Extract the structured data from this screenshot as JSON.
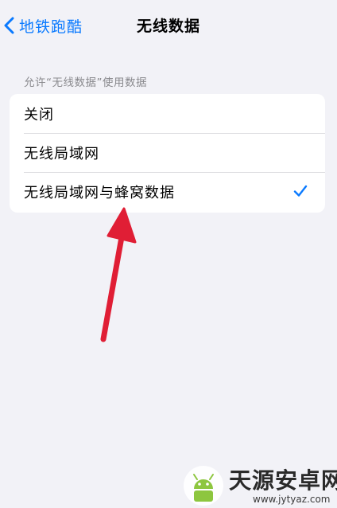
{
  "nav": {
    "back_label": "地铁跑酷",
    "title": "无线数据"
  },
  "section": {
    "header": "允许“无线数据”使用数据"
  },
  "options": [
    {
      "label": "关闭",
      "selected": false
    },
    {
      "label": "无线局域网",
      "selected": false
    },
    {
      "label": "无线局域网与蜂窝数据",
      "selected": true
    }
  ],
  "colors": {
    "accent": "#0a7aff",
    "arrow": "#e01e35",
    "background": "#f2f2f7"
  },
  "watermark": {
    "name": "天源安卓网",
    "url": "www.jytyaz.com"
  }
}
